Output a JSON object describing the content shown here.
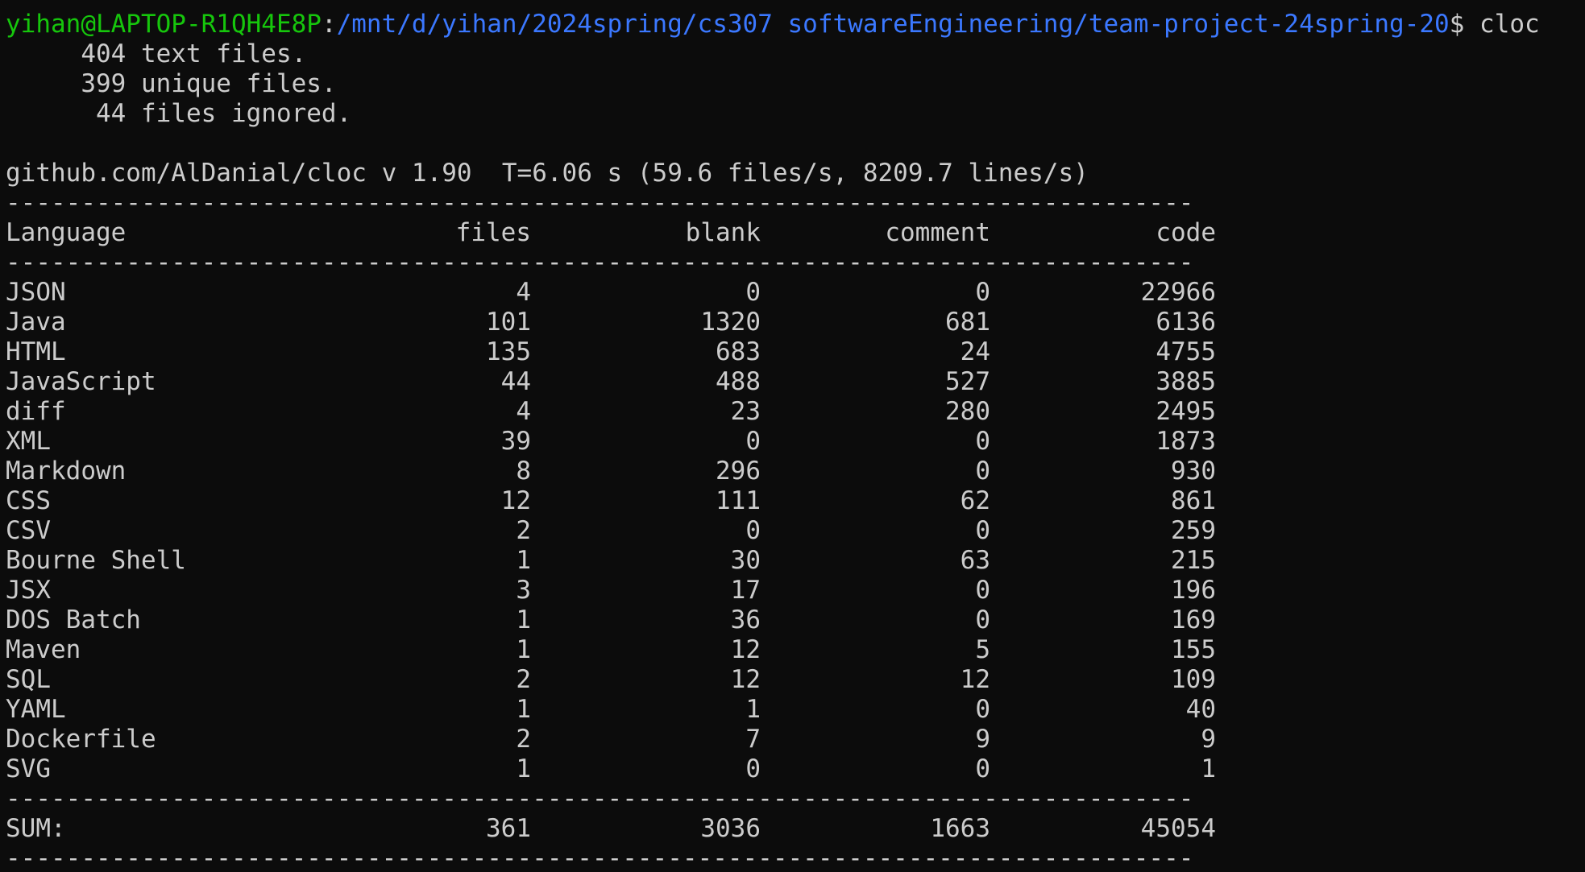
{
  "terminal": {
    "prompt_user": "yihan@LAPTOP-R1QH4E8P",
    "prompt_colon": ":",
    "prompt_path": "/mnt/d/yihan/2024spring/cs307 softwareEngineering/team-project-24spring-20",
    "prompt_symbol": "$ ",
    "command": "cloc",
    "summary": [
      "     404 text files.",
      "     399 unique files.",
      "      44 files ignored."
    ],
    "cloc_info": "github.com/AlDanial/cloc v 1.90  T=6.06 s (59.6 files/s, 8209.7 lines/s)",
    "separator": "-------------------------------------------------------------------------------",
    "headers": {
      "language": "Language",
      "files": "files",
      "blank": "blank",
      "comment": "comment",
      "code": "code"
    },
    "rows": [
      {
        "language": "JSON",
        "files": "4",
        "blank": "0",
        "comment": "0",
        "code": "22966"
      },
      {
        "language": "Java",
        "files": "101",
        "blank": "1320",
        "comment": "681",
        "code": "6136"
      },
      {
        "language": "HTML",
        "files": "135",
        "blank": "683",
        "comment": "24",
        "code": "4755"
      },
      {
        "language": "JavaScript",
        "files": "44",
        "blank": "488",
        "comment": "527",
        "code": "3885"
      },
      {
        "language": "diff",
        "files": "4",
        "blank": "23",
        "comment": "280",
        "code": "2495"
      },
      {
        "language": "XML",
        "files": "39",
        "blank": "0",
        "comment": "0",
        "code": "1873"
      },
      {
        "language": "Markdown",
        "files": "8",
        "blank": "296",
        "comment": "0",
        "code": "930"
      },
      {
        "language": "CSS",
        "files": "12",
        "blank": "111",
        "comment": "62",
        "code": "861"
      },
      {
        "language": "CSV",
        "files": "2",
        "blank": "0",
        "comment": "0",
        "code": "259"
      },
      {
        "language": "Bourne Shell",
        "files": "1",
        "blank": "30",
        "comment": "63",
        "code": "215"
      },
      {
        "language": "JSX",
        "files": "3",
        "blank": "17",
        "comment": "0",
        "code": "196"
      },
      {
        "language": "DOS Batch",
        "files": "1",
        "blank": "36",
        "comment": "0",
        "code": "169"
      },
      {
        "language": "Maven",
        "files": "1",
        "blank": "12",
        "comment": "5",
        "code": "155"
      },
      {
        "language": "SQL",
        "files": "2",
        "blank": "12",
        "comment": "12",
        "code": "109"
      },
      {
        "language": "YAML",
        "files": "1",
        "blank": "1",
        "comment": "0",
        "code": "40"
      },
      {
        "language": "Dockerfile",
        "files": "2",
        "blank": "7",
        "comment": "9",
        "code": "9"
      },
      {
        "language": "SVG",
        "files": "1",
        "blank": "0",
        "comment": "0",
        "code": "1"
      }
    ],
    "sum": {
      "language": "SUM:",
      "files": "361",
      "blank": "3036",
      "comment": "1663",
      "code": "45054"
    }
  },
  "colors": {
    "background": "#0c0c0c",
    "text": "#cccccc",
    "prompt_user": "#16c60c",
    "prompt_path": "#3b78ff"
  }
}
